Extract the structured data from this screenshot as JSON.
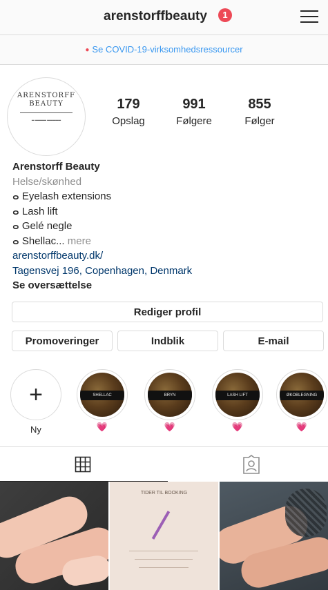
{
  "header": {
    "username": "arenstorffbeauty",
    "notification_count": "1",
    "menu_icon": "hamburger-icon"
  },
  "covid_banner": {
    "text": "Se COVID-19-virksomhedsressourcer"
  },
  "profile": {
    "avatar_lines": [
      "ARENSTORFF",
      "BEAUTY"
    ],
    "stats": [
      {
        "value": "179",
        "label": "Opslag"
      },
      {
        "value": "991",
        "label": "Følgere"
      },
      {
        "value": "855",
        "label": "Følger"
      }
    ]
  },
  "bio": {
    "name": "Arenstorff Beauty",
    "category": "Helse/skønhed",
    "lines": [
      "Eyelash extensions",
      "Lash lift",
      "Gelé negle",
      "Shellac..."
    ],
    "line_glyph": "ⴰ",
    "more": "mere",
    "website": "arenstorffbeauty.dk/",
    "address": "Tagensvej 196, Copenhagen, Denmark",
    "translate": "Se oversættelse"
  },
  "buttons": {
    "edit_profile": "Rediger profil",
    "promotions": "Promoveringer",
    "insights": "Indblik",
    "email": "E-mail"
  },
  "highlights": {
    "new_label": "Ny",
    "items": [
      {
        "label": "SHELLAC"
      },
      {
        "label": "BRYN"
      },
      {
        "label": "LASH LIFT"
      },
      {
        "label": "ØKOBLEGNING"
      }
    ],
    "heart": "💗"
  },
  "tabs": {
    "grid_icon": "grid-icon",
    "tagged_icon": "tagged-person-icon"
  },
  "posts": {
    "post2_title": "TIDER TIL BOOKING"
  },
  "colors": {
    "accent": "#3897f0",
    "badge": "#ed4956",
    "link": "#00376b"
  }
}
